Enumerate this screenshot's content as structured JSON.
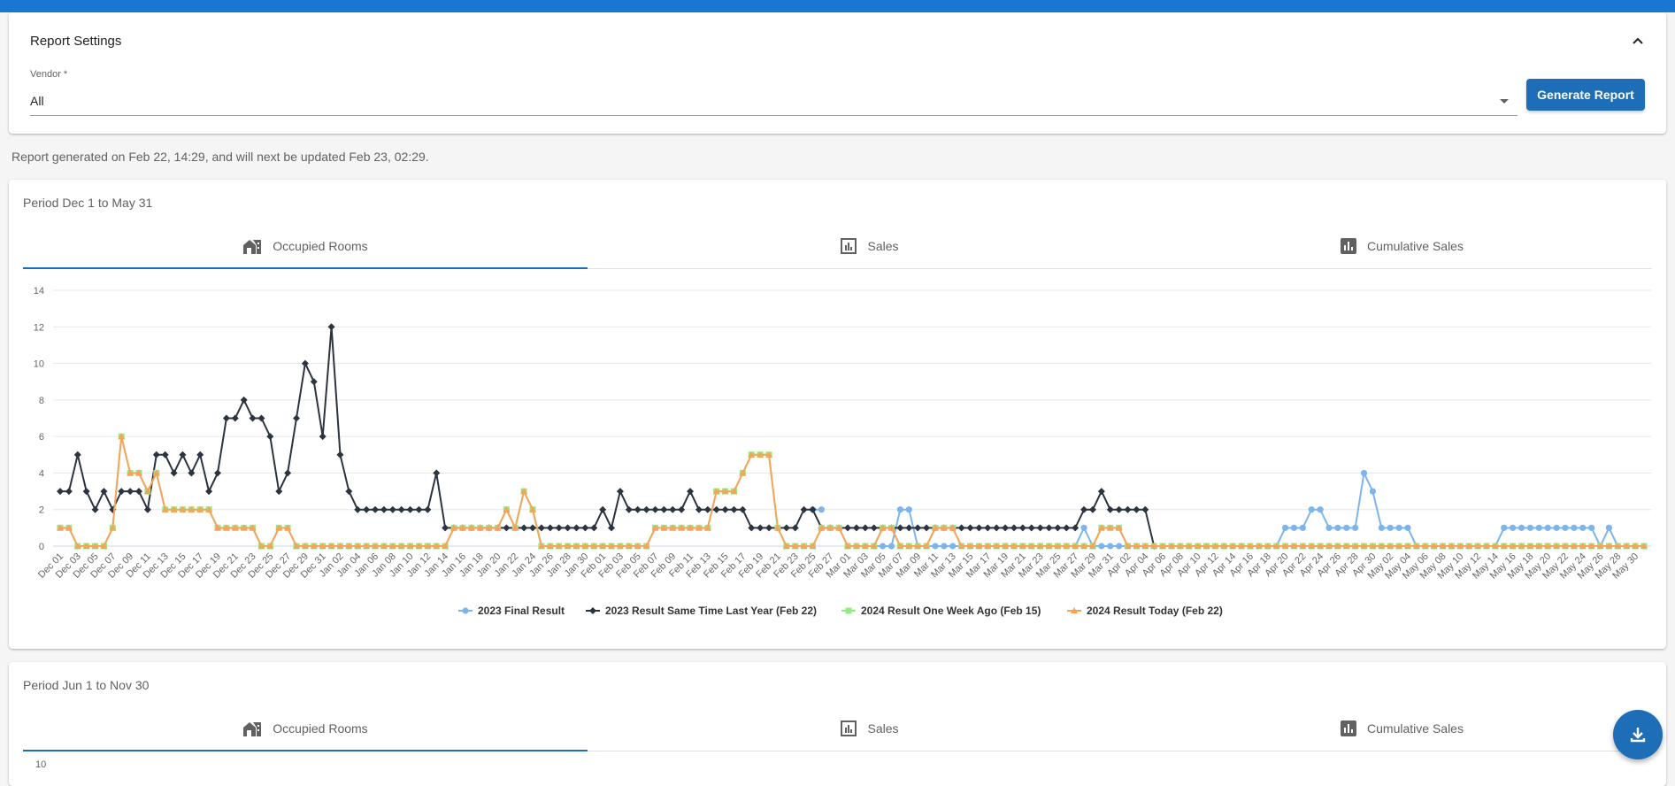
{
  "settings": {
    "title": "Report Settings",
    "vendor_label": "Vendor *",
    "vendor_value": "All",
    "generate_label": "Generate Report"
  },
  "generated_note": "Report generated on Feb 22, 14:29, and will next be updated Feb 23, 02:29.",
  "period1": {
    "title": "Period Dec 1 to May 31",
    "tabs": [
      "Occupied Rooms",
      "Sales",
      "Cumulative Sales"
    ]
  },
  "period2": {
    "title": "Period Jun 1 to Nov 30",
    "tabs": [
      "Occupied Rooms",
      "Sales",
      "Cumulative Sales"
    ],
    "first_tick": "10"
  },
  "colors": {
    "accent": "#1e6db7",
    "s2023_final": "#7cb5ec",
    "s2023_lastyear": "#2b3440",
    "s2024_weekago": "#90ed7d",
    "s2024_today": "#f7a35c"
  },
  "icons": {
    "collapse": "chevron-up-icon",
    "occupied": "house-icon",
    "sales": "bar-chart-icon",
    "cumulative": "bar-chart-filled-icon",
    "fab": "download-icon"
  },
  "chart_data": {
    "type": "line",
    "title": "",
    "ylim": [
      0,
      14
    ],
    "yticks": [
      0,
      2,
      4,
      6,
      8,
      10,
      12,
      14
    ],
    "grid": true,
    "legend_position": "bottom-center",
    "x_tick_labels": [
      "Dec 01",
      "Dec 03",
      "Dec 05",
      "Dec 07",
      "Dec 09",
      "Dec 11",
      "Dec 13",
      "Dec 15",
      "Dec 17",
      "Dec 19",
      "Dec 21",
      "Dec 23",
      "Dec 25",
      "Dec 27",
      "Dec 29",
      "Dec 31",
      "Jan 02",
      "Jan 04",
      "Jan 06",
      "Jan 08",
      "Jan 10",
      "Jan 12",
      "Jan 14",
      "Jan 16",
      "Jan 18",
      "Jan 20",
      "Jan 22",
      "Jan 24",
      "Jan 26",
      "Jan 28",
      "Jan 30",
      "Feb 01",
      "Feb 03",
      "Feb 05",
      "Feb 07",
      "Feb 09",
      "Feb 11",
      "Feb 13",
      "Feb 15",
      "Feb 17",
      "Feb 19",
      "Feb 21",
      "Feb 23",
      "Feb 25",
      "Feb 27",
      "Mar 01",
      "Mar 03",
      "Mar 05",
      "Mar 07",
      "Mar 09",
      "Mar 11",
      "Mar 13",
      "Mar 15",
      "Mar 17",
      "Mar 19",
      "Mar 21",
      "Mar 23",
      "Mar 25",
      "Mar 27",
      "Mar 29",
      "Mar 31",
      "Apr 02",
      "Apr 04",
      "Apr 06",
      "Apr 08",
      "Apr 10",
      "Apr 12",
      "Apr 14",
      "Apr 16",
      "Apr 18",
      "Apr 20",
      "Apr 22",
      "Apr 24",
      "Apr 26",
      "Apr 28",
      "Apr 30",
      "May 02",
      "May 04",
      "May 06",
      "May 08",
      "May 10",
      "May 12",
      "May 14",
      "May 16",
      "May 18",
      "May 20",
      "May 22",
      "May 24",
      "May 26",
      "May 28",
      "May 30"
    ],
    "series": [
      {
        "name": "2023 Final Result",
        "marker": "circle",
        "runs": [
          [
            0,
            0,
            0,
            0,
            0,
            0,
            0,
            0,
            0,
            0,
            0,
            0,
            0,
            0,
            0,
            0,
            0,
            0,
            0,
            0,
            0,
            0,
            0,
            0,
            0,
            0,
            0,
            0,
            0,
            0,
            0,
            0,
            0,
            0,
            0,
            0,
            0,
            0,
            0,
            0,
            0,
            0,
            0,
            0,
            0,
            0,
            0,
            0,
            0,
            0,
            0,
            0,
            0,
            0,
            0,
            0,
            0,
            0,
            0,
            0,
            0,
            0,
            0,
            0,
            0,
            0,
            0,
            0,
            0,
            0,
            0,
            0,
            0,
            0,
            0,
            0,
            0,
            0,
            0,
            0,
            0,
            0,
            0,
            0,
            0,
            0,
            0,
            0,
            0,
            0,
            0,
            0,
            0,
            0,
            0,
            0,
            0,
            0,
            0,
            0,
            0,
            0,
            0,
            0,
            0,
            0,
            0,
            0,
            0,
            0,
            0,
            0,
            0,
            0,
            0,
            0,
            0,
            0,
            0,
            0,
            0,
            0,
            0,
            0,
            0,
            0,
            0,
            0,
            0,
            0,
            0,
            0,
            0,
            0,
            0,
            0,
            0,
            0,
            0,
            0,
            0,
            0,
            0,
            0,
            0,
            0,
            0,
            0,
            0,
            0,
            0,
            0,
            0,
            0,
            0,
            0,
            0,
            0,
            0,
            0,
            0,
            0,
            0,
            0,
            0,
            0,
            0,
            0,
            0,
            0,
            0,
            0,
            0,
            0,
            0,
            0,
            0,
            0,
            0,
            0,
            0,
            0
          ]
        ],
        "values": [
          null,
          null,
          null,
          null,
          null,
          null,
          null,
          null,
          null,
          null,
          null,
          null,
          null,
          null,
          null,
          null,
          null,
          null,
          null,
          null,
          null,
          null,
          null,
          null,
          null,
          null,
          null,
          null,
          null,
          null,
          null,
          null,
          null,
          null,
          null,
          null,
          null,
          null,
          null,
          null,
          null,
          null,
          null,
          null,
          null,
          null,
          null,
          null,
          null,
          null,
          null,
          null,
          null,
          null,
          null,
          null,
          null,
          null,
          null,
          null,
          null,
          null,
          null,
          null,
          null,
          null,
          null,
          null,
          null,
          null,
          null,
          null,
          null,
          null,
          null,
          null,
          null,
          null,
          null,
          null,
          null,
          null,
          null,
          null,
          null,
          null,
          null,
          null,
          null,
          null,
          null,
          0,
          0,
          0,
          0,
          0,
          0,
          0,
          0,
          0,
          0,
          0,
          0,
          0,
          0,
          0,
          0,
          0,
          0,
          0,
          0,
          0,
          0,
          0,
          0,
          0,
          0,
          1,
          0,
          0,
          0,
          0,
          0,
          0,
          0,
          0,
          0,
          0,
          0,
          0,
          0,
          0,
          0,
          0,
          0,
          0,
          0,
          0,
          0,
          0,
          1,
          1,
          1,
          2,
          2,
          1,
          1,
          1,
          1,
          4,
          3,
          1,
          1,
          1,
          1,
          0,
          0,
          0,
          0,
          0,
          0,
          0,
          0,
          0,
          0,
          1,
          1,
          1,
          1,
          1,
          1,
          1,
          1,
          1,
          1,
          1,
          0,
          1,
          0,
          0,
          0,
          0,
          0,
          0,
          0,
          0,
          0,
          1,
          1,
          1,
          1,
          0
        ],
        "early_overrides": {
          "86": 2,
          "87": 2,
          "96": 2,
          "97": 2
        }
      },
      {
        "name": "2023 Result Same Time Last Year (Feb 22)",
        "marker": "diamond",
        "values": [
          3,
          3,
          5,
          3,
          2,
          3,
          2,
          3,
          3,
          3,
          2,
          5,
          5,
          4,
          5,
          4,
          5,
          3,
          4,
          7,
          7,
          8,
          7,
          7,
          6,
          3,
          4,
          7,
          10,
          9,
          6,
          12,
          5,
          3,
          2,
          2,
          2,
          2,
          2,
          2,
          2,
          2,
          2,
          4,
          1,
          1,
          1,
          1,
          1,
          1,
          1,
          1,
          1,
          1,
          1,
          1,
          1,
          1,
          1,
          1,
          1,
          1,
          2,
          1,
          3,
          2,
          2,
          2,
          2,
          2,
          2,
          2,
          3,
          2,
          2,
          2,
          2,
          2,
          2,
          1,
          1,
          1,
          1,
          1,
          1,
          2,
          2,
          1,
          1,
          1,
          1,
          1,
          1,
          1,
          1,
          1,
          1,
          1,
          1,
          1,
          1,
          1,
          1,
          1,
          1,
          1,
          1,
          1,
          1,
          1,
          1,
          1,
          1,
          1,
          1,
          1,
          1,
          2,
          2,
          3,
          2,
          2,
          2,
          2,
          2,
          0
        ]
      },
      {
        "name": "2024 Result One Week Ago (Feb 15)",
        "marker": "square",
        "values": [
          1,
          1,
          0,
          0,
          0,
          0,
          1,
          6,
          4,
          4,
          3,
          4,
          2,
          2,
          2,
          2,
          2,
          2,
          1,
          1,
          1,
          1,
          1,
          0,
          0,
          1,
          1,
          0,
          0,
          0,
          0,
          0,
          0,
          0,
          0,
          0,
          0,
          0,
          0,
          0,
          0,
          0,
          0,
          0,
          0,
          1,
          1,
          1,
          1,
          1,
          1,
          2,
          1,
          3,
          2,
          0,
          0,
          0,
          0,
          0,
          0,
          0,
          0,
          0,
          0,
          0,
          0,
          0,
          1,
          1,
          1,
          1,
          1,
          1,
          1,
          3,
          3,
          3,
          4,
          5,
          5,
          5,
          1,
          0,
          0,
          0,
          0,
          1,
          1,
          1,
          0,
          0,
          0,
          0,
          1,
          1,
          0,
          0,
          0,
          0,
          1,
          1,
          1,
          0,
          0,
          0,
          0,
          0,
          0,
          0,
          0,
          0,
          0,
          0,
          0,
          0,
          0,
          0,
          0,
          1,
          1,
          1,
          0,
          0,
          0,
          0,
          0,
          0,
          0,
          0,
          0,
          0,
          0,
          0,
          0,
          0,
          0,
          0,
          0,
          0,
          0,
          0,
          0,
          0,
          0,
          0,
          0,
          0,
          0,
          0,
          0,
          0,
          0,
          0,
          0,
          0,
          0,
          0,
          0,
          0,
          0,
          0,
          0,
          0,
          0,
          0,
          0,
          0,
          0,
          0,
          0,
          0,
          0,
          0,
          0,
          0,
          0,
          0,
          0,
          0,
          0,
          0,
          0,
          0,
          0,
          0
        ]
      },
      {
        "name": "2024 Result Today (Feb 22)",
        "marker": "triangle",
        "values": [
          1,
          1,
          0,
          0,
          0,
          0,
          1,
          6,
          4,
          4,
          3,
          4,
          2,
          2,
          2,
          2,
          2,
          2,
          1,
          1,
          1,
          1,
          1,
          0,
          0,
          1,
          1,
          0,
          0,
          0,
          0,
          0,
          0,
          0,
          0,
          0,
          0,
          0,
          0,
          0,
          0,
          0,
          0,
          0,
          0,
          1,
          1,
          1,
          1,
          1,
          1,
          2,
          1,
          3,
          2,
          0,
          0,
          0,
          0,
          0,
          0,
          0,
          0,
          0,
          0,
          0,
          0,
          0,
          1,
          1,
          1,
          1,
          1,
          1,
          1,
          3,
          3,
          3,
          4,
          5,
          5,
          5,
          1,
          0,
          0,
          0,
          0,
          1,
          1,
          1,
          0,
          0,
          0,
          0,
          1,
          1,
          0,
          0,
          0,
          0,
          1,
          1,
          1,
          0,
          0,
          0,
          0,
          0,
          0,
          0,
          0,
          0,
          0,
          0,
          0,
          0,
          0,
          0,
          0,
          1,
          1,
          1,
          0,
          0,
          0,
          0,
          0,
          0,
          0,
          0,
          0,
          0,
          0,
          0,
          0,
          0,
          0,
          0,
          0,
          0,
          0,
          0,
          0,
          0,
          0,
          0,
          0,
          0,
          0,
          0,
          0,
          0,
          0,
          0,
          0,
          0,
          0,
          0,
          0,
          0,
          0,
          0,
          0,
          0,
          0,
          0,
          0,
          0,
          0,
          0,
          0,
          0,
          0,
          0,
          0,
          0,
          0,
          0,
          0,
          0,
          0,
          0,
          0,
          0,
          0,
          0
        ]
      }
    ]
  }
}
